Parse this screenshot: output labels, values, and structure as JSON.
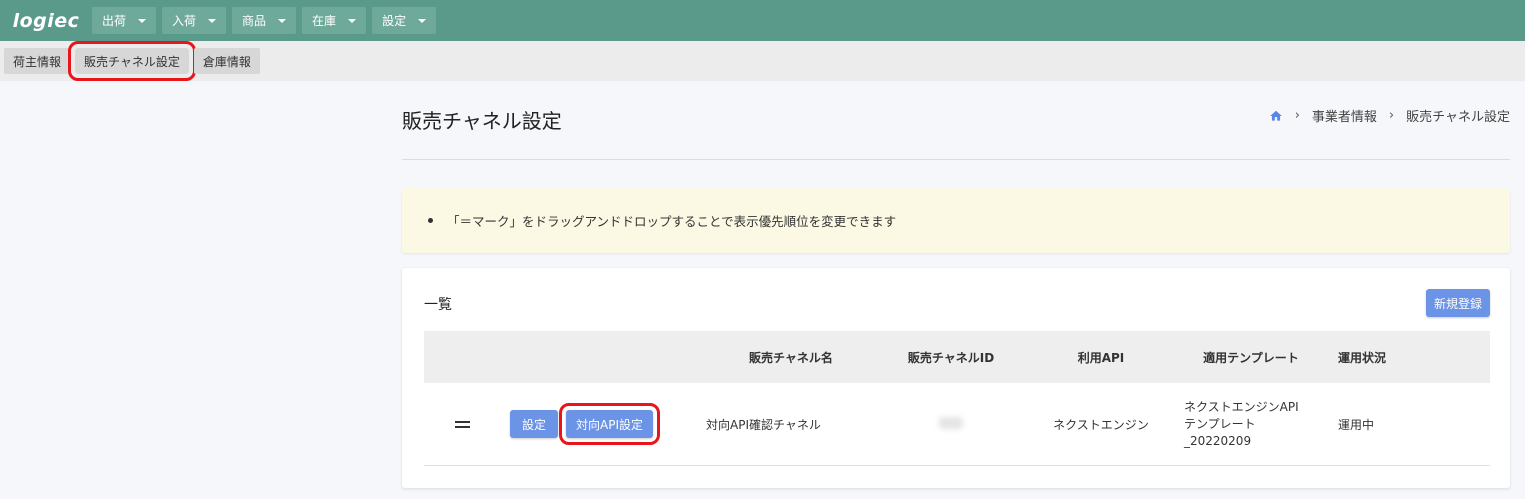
{
  "header": {
    "logo_text": "logiec",
    "nav": [
      {
        "label": "出荷"
      },
      {
        "label": "入荷"
      },
      {
        "label": "商品"
      },
      {
        "label": "在庫"
      },
      {
        "label": "設定"
      }
    ]
  },
  "subnav": {
    "tabs": [
      {
        "label": "荷主情報"
      },
      {
        "label": "販売チャネル設定"
      },
      {
        "label": "倉庫情報"
      }
    ]
  },
  "page": {
    "title": "販売チャネル設定",
    "breadcrumb": [
      "事業者情報",
      "販売チャネル設定"
    ]
  },
  "notice": {
    "text": "「＝マーク」をドラッグアンドドロップすることで表示優先順位を変更できます"
  },
  "list": {
    "title": "一覧",
    "new_button": "新規登録",
    "columns": [
      "販売チャネル名",
      "販売チャネルID",
      "利用API",
      "適用テンプレート",
      "運用状況"
    ],
    "rows": [
      {
        "settings_button": "設定",
        "api_button": "対向API設定",
        "channel_name": "対向API確認チャネル",
        "api": "ネクストエンジン",
        "template_line1": "ネクストエンジンAPI",
        "template_line2": "テンプレート",
        "template_line3": "_20220209",
        "status": "運用中"
      }
    ]
  },
  "colors": {
    "header_bg": "#5a9a8a",
    "accent_blue": "#6b93e6",
    "highlight_red": "#e8161b",
    "notice_bg": "#fbf8e4"
  }
}
